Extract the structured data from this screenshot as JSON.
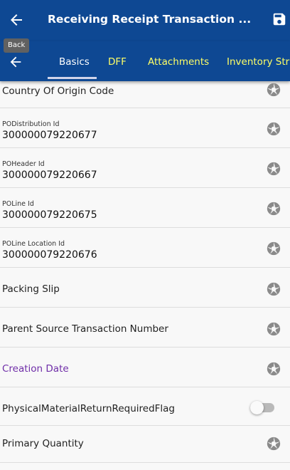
{
  "header": {
    "title": "Receiving Receipt Transaction ...",
    "back_tooltip": "Back"
  },
  "tabs": [
    {
      "label": "Basics",
      "active": true
    },
    {
      "label": "DFF",
      "active": false
    },
    {
      "label": "Attachments",
      "active": false
    },
    {
      "label": "Inventory Str",
      "active": false
    }
  ],
  "fields": [
    {
      "label": "Country Of Origin Code",
      "control": "camera-icon"
    },
    {
      "caption": "PODistribution Id",
      "value": "300000079220677",
      "control": "camera-icon"
    },
    {
      "caption": "POHeader Id",
      "value": "300000079220667",
      "control": "camera-icon"
    },
    {
      "caption": "POLine Id",
      "value": "300000079220675",
      "control": "camera-icon"
    },
    {
      "caption": "POLine Location Id",
      "value": "300000079220676",
      "control": "camera-icon"
    },
    {
      "label": "Packing Slip",
      "control": "camera-icon"
    },
    {
      "label": "Parent Source Transaction Number",
      "control": "camera-icon"
    },
    {
      "label": "Creation Date",
      "control": "camera-icon",
      "label_color": "#6f2da8"
    },
    {
      "label": "PhysicalMaterialReturnRequiredFlag",
      "control": "toggle",
      "toggle_on": false
    },
    {
      "label": "Primary Quantity",
      "control": "camera-icon"
    }
  ],
  "colors": {
    "header_bg": "#0e4893",
    "active_tab": "#ffffff",
    "inactive_tab": "#ffff66",
    "accent_label": "#6f2da8",
    "icon_gray": "#8a8a8a"
  }
}
